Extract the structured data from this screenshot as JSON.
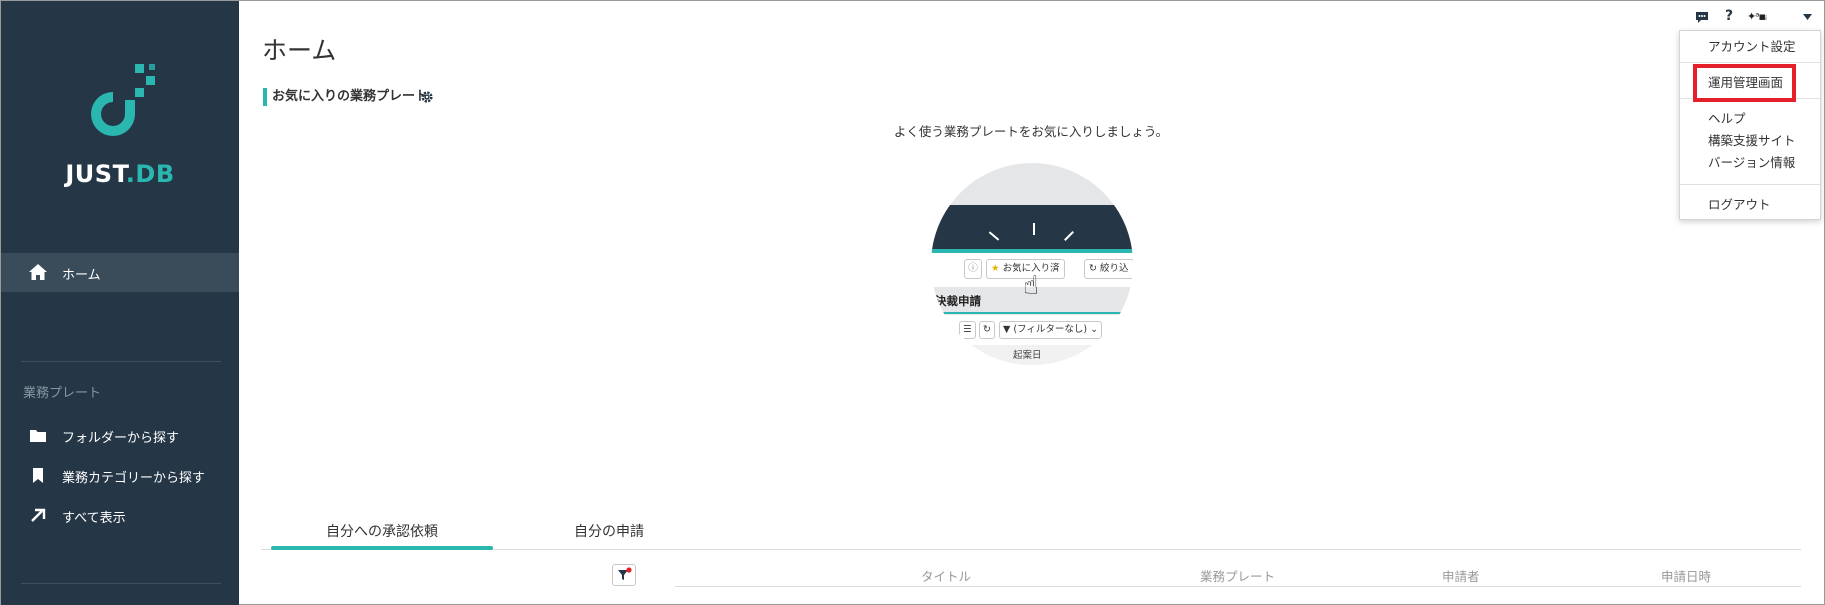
{
  "sidebar": {
    "logo": {
      "text_main": "JUST",
      "text_dot": ".",
      "text_db": "DB"
    },
    "nav": [
      {
        "label": "ホーム",
        "icon": "home-icon",
        "active": true
      }
    ],
    "section_label": "業務プレート",
    "items": [
      {
        "label": "フォルダーから探す",
        "icon": "folder-icon"
      },
      {
        "label": "業務カテゴリーから探す",
        "icon": "bookmark-icon"
      },
      {
        "label": "すべて表示",
        "icon": "arrow-up-right-icon"
      }
    ]
  },
  "header": {
    "title": "ホーム",
    "icons": [
      "chat-icon",
      "help-icon",
      "user-avatar-icon",
      "caret-down-icon"
    ],
    "help_glyph": "?",
    "user_name": "✦ᵃ▪ᵢ"
  },
  "favorites": {
    "heading": "お気に入りの業務プレート",
    "hint": "よく使う業務プレートをお気に入りしましょう。",
    "illustration": {
      "favorite_pill": "お気に入り済",
      "filter_pill": "絞り込",
      "section_title": "決裁申請",
      "filter_none": "(フィルターなし)",
      "column": "起案日"
    }
  },
  "tabs": [
    {
      "label": "自分への承認依頼",
      "active": true
    },
    {
      "label": "自分の申請",
      "active": false
    }
  ],
  "table": {
    "columns": [
      "タイトル",
      "業務プレート",
      "申請者",
      "申請日時"
    ]
  },
  "user_menu": {
    "items": [
      {
        "label": "アカウント設定"
      },
      {
        "label": "運用管理画面",
        "highlighted": true
      },
      {
        "label": "ヘルプ"
      },
      {
        "label": "構築支援サイト"
      },
      {
        "label": "バージョン情報"
      },
      {
        "label": "ログアウト"
      }
    ]
  },
  "colors": {
    "sidebar": "#253746",
    "accent": "#2ab7b0",
    "highlight": "#e5202a"
  }
}
